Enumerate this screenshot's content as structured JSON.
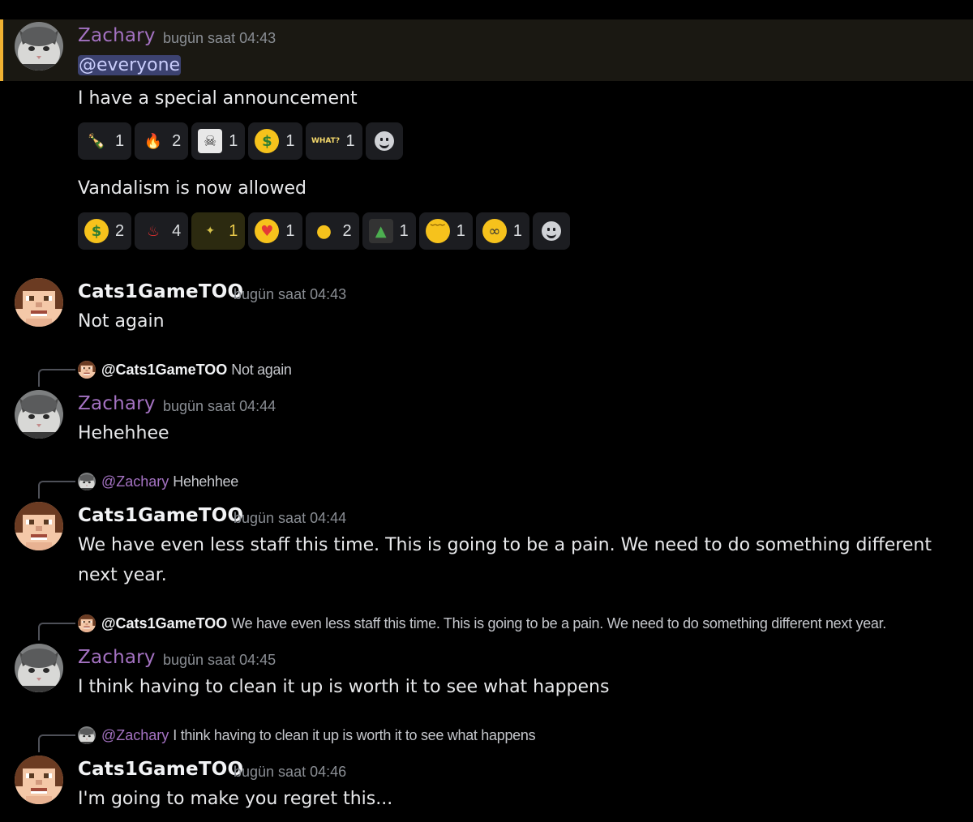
{
  "users": {
    "zachary": {
      "name": "Zachary",
      "color": "#a472c2",
      "avatar": "cat-avatar"
    },
    "cats": {
      "name": "Cats1GameTOO",
      "color": "#f2f3f5",
      "avatar": "blocky-face-avatar"
    }
  },
  "messages": [
    {
      "author": "Zachary",
      "timestamp": "bugün saat 04:43",
      "mention": "@everyone",
      "highlighted": true
    },
    {
      "author": "Cats1GameTOO",
      "timestamp": "bugün saat 04:43",
      "text": "Not again"
    },
    {
      "author": "Zachary",
      "timestamp": "bugün saat 04:44",
      "text": "Hehehhee",
      "reply": {
        "user": "@Cats1GameTOO",
        "text": "Not again"
      }
    },
    {
      "author": "Cats1GameTOO",
      "timestamp": "bugün saat 04:44",
      "text": "We have even less staff this time. This is going to be a pain. We need to do something different next year.",
      "reply": {
        "user": "@Zachary",
        "text": "Hehehhee"
      }
    },
    {
      "author": "Zachary",
      "timestamp": "bugün saat 04:45",
      "text": "I think having to clean it up is worth it to see what happens",
      "reply": {
        "user": "@Cats1GameTOO",
        "text": "We have even less staff this time. This is going to be a pain. We need to do something different next year."
      }
    },
    {
      "author": "Cats1GameTOO",
      "timestamp": "bugün saat 04:46",
      "text": "I'm going to make you regret this...",
      "reply": {
        "user": "@Zachary",
        "text": "I think having to clean it up is worth it to see what happens"
      }
    }
  ],
  "followups": [
    {
      "text": "I have a special announcement"
    },
    {
      "text": "Vandalism is now allowed"
    }
  ],
  "reactions_1": [
    {
      "emoji": "bottle-emoji",
      "glyph": "🍾",
      "count": "1"
    },
    {
      "emoji": "fire-emoji",
      "glyph": "🔥",
      "count": "2"
    },
    {
      "emoji": "skull-face-emoji",
      "glyph": "☠",
      "count": "1"
    },
    {
      "emoji": "money-face-emoji",
      "glyph": "$",
      "count": "1"
    },
    {
      "emoji": "what-emoji",
      "glyph": "WHAT?",
      "count": "1"
    }
  ],
  "reactions_2": [
    {
      "emoji": "money-face-emoji",
      "glyph": "$",
      "count": "2"
    },
    {
      "emoji": "red-devil-emoji",
      "glyph": "♨",
      "count": "4"
    },
    {
      "emoji": "dizzy-emoji",
      "glyph": "✦",
      "count": "1",
      "active": true
    },
    {
      "emoji": "heart-eyes-emoji",
      "glyph": "♥",
      "count": "1"
    },
    {
      "emoji": "bald-face-emoji",
      "glyph": "●",
      "count": "2"
    },
    {
      "emoji": "pepe-emoji",
      "glyph": "▲",
      "count": "1"
    },
    {
      "emoji": "pensive-emoji",
      "glyph": "﹋",
      "count": "1"
    },
    {
      "emoji": "salute-emoji",
      "glyph": "∞",
      "count": "1"
    }
  ],
  "colors": {
    "background": "#000000",
    "highlight_bar": "#f0b232",
    "mention_bg": "#3c4270",
    "zachary": "#a472c2"
  }
}
